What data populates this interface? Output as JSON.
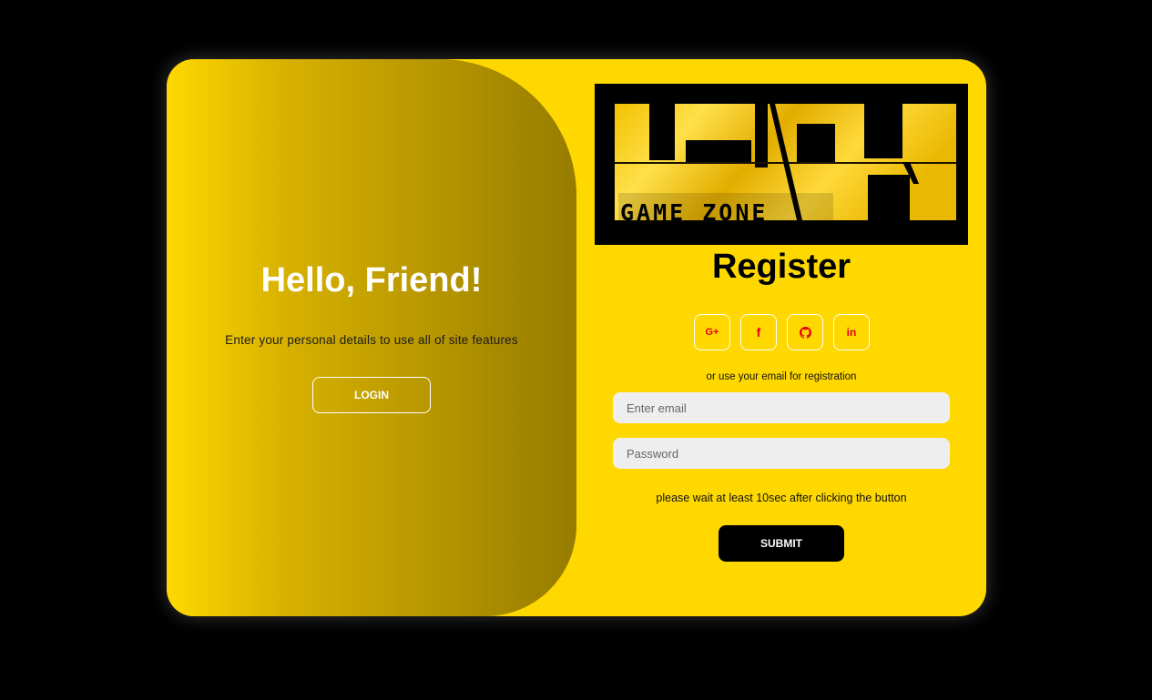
{
  "overlay": {
    "title": "Hello, Friend!",
    "text": "Enter your personal details to use all of site features",
    "login_label": "LOGIN"
  },
  "logo": {
    "caption": "GAME ZONE",
    "icon": "game-zone-logo"
  },
  "register": {
    "title": "Register",
    "socials": [
      {
        "icon": "google-plus-icon",
        "glyph": "G+"
      },
      {
        "icon": "facebook-icon",
        "glyph": "f"
      },
      {
        "icon": "github-icon",
        "glyph": ""
      },
      {
        "icon": "linkedin-icon",
        "glyph": "in"
      }
    ],
    "or_text": "or use your email for registration",
    "email_placeholder": "Enter email",
    "password_placeholder": "Password",
    "wait_text": "please wait at least 10sec after clicking the button",
    "submit_label": "SUBMIT"
  },
  "colors": {
    "page_background": "#000000",
    "card_background": "#ffd800",
    "icon_accent": "#e3001b",
    "submit_background": "#000000",
    "input_background": "#eeeeee"
  }
}
